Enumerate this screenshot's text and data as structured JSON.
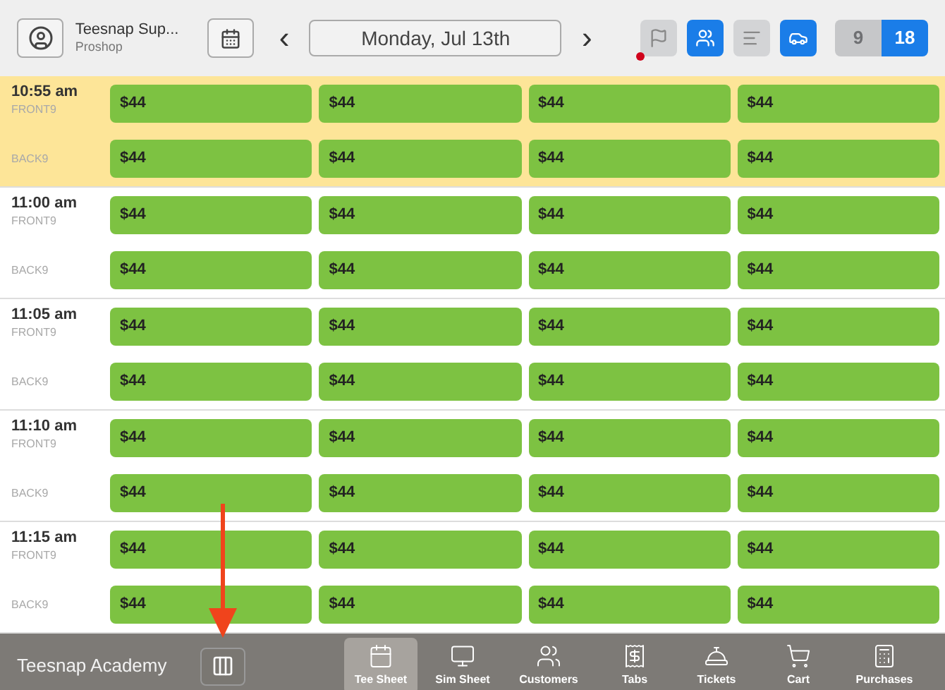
{
  "header": {
    "account_name": "Teesnap Sup...",
    "account_role": "Proshop",
    "date": "Monday, Jul 13th",
    "prev": "‹",
    "next": "›",
    "toggles": [
      {
        "kind": "flag",
        "selected": false,
        "alert": true
      },
      {
        "kind": "players",
        "selected": true,
        "alert": false
      },
      {
        "kind": "bars",
        "selected": false,
        "alert": false
      },
      {
        "kind": "cart",
        "selected": true,
        "alert": false
      }
    ],
    "holes": [
      {
        "label": "9",
        "selected": false
      },
      {
        "label": "18",
        "selected": true
      }
    ]
  },
  "tee_times": [
    {
      "time": "10:55 am",
      "highlighted": true,
      "rows": [
        {
          "label": "FRONT9",
          "slots": [
            "$44",
            "$44",
            "$44",
            "$44"
          ]
        },
        {
          "label": "BACK9",
          "slots": [
            "$44",
            "$44",
            "$44",
            "$44"
          ]
        }
      ]
    },
    {
      "time": "11:00 am",
      "highlighted": false,
      "rows": [
        {
          "label": "FRONT9",
          "slots": [
            "$44",
            "$44",
            "$44",
            "$44"
          ]
        },
        {
          "label": "BACK9",
          "slots": [
            "$44",
            "$44",
            "$44",
            "$44"
          ]
        }
      ]
    },
    {
      "time": "11:05 am",
      "highlighted": false,
      "rows": [
        {
          "label": "FRONT9",
          "slots": [
            "$44",
            "$44",
            "$44",
            "$44"
          ]
        },
        {
          "label": "BACK9",
          "slots": [
            "$44",
            "$44",
            "$44",
            "$44"
          ]
        }
      ]
    },
    {
      "time": "11:10 am",
      "highlighted": false,
      "rows": [
        {
          "label": "FRONT9",
          "slots": [
            "$44",
            "$44",
            "$44",
            "$44"
          ]
        },
        {
          "label": "BACK9",
          "slots": [
            "$44",
            "$44",
            "$44",
            "$44"
          ]
        }
      ]
    },
    {
      "time": "11:15 am",
      "highlighted": false,
      "rows": [
        {
          "label": "FRONT9",
          "slots": [
            "$44",
            "$44",
            "$44",
            "$44"
          ]
        },
        {
          "label": "BACK9",
          "slots": [
            "$44",
            "$44",
            "$44",
            "$44"
          ]
        }
      ]
    }
  ],
  "bottom_bar": {
    "title": "Teesnap Academy",
    "tabs": [
      {
        "kind": "tee-sheet",
        "label": "Tee Sheet",
        "selected": true
      },
      {
        "kind": "sim-sheet",
        "label": "Sim Sheet",
        "selected": false
      },
      {
        "kind": "customers",
        "label": "Customers",
        "selected": false
      },
      {
        "kind": "tabs",
        "label": "Tabs",
        "selected": false
      },
      {
        "kind": "tickets",
        "label": "Tickets",
        "selected": false
      },
      {
        "kind": "cart",
        "label": "Cart",
        "selected": false
      },
      {
        "kind": "purchases",
        "label": "Purchases",
        "selected": false
      }
    ]
  }
}
